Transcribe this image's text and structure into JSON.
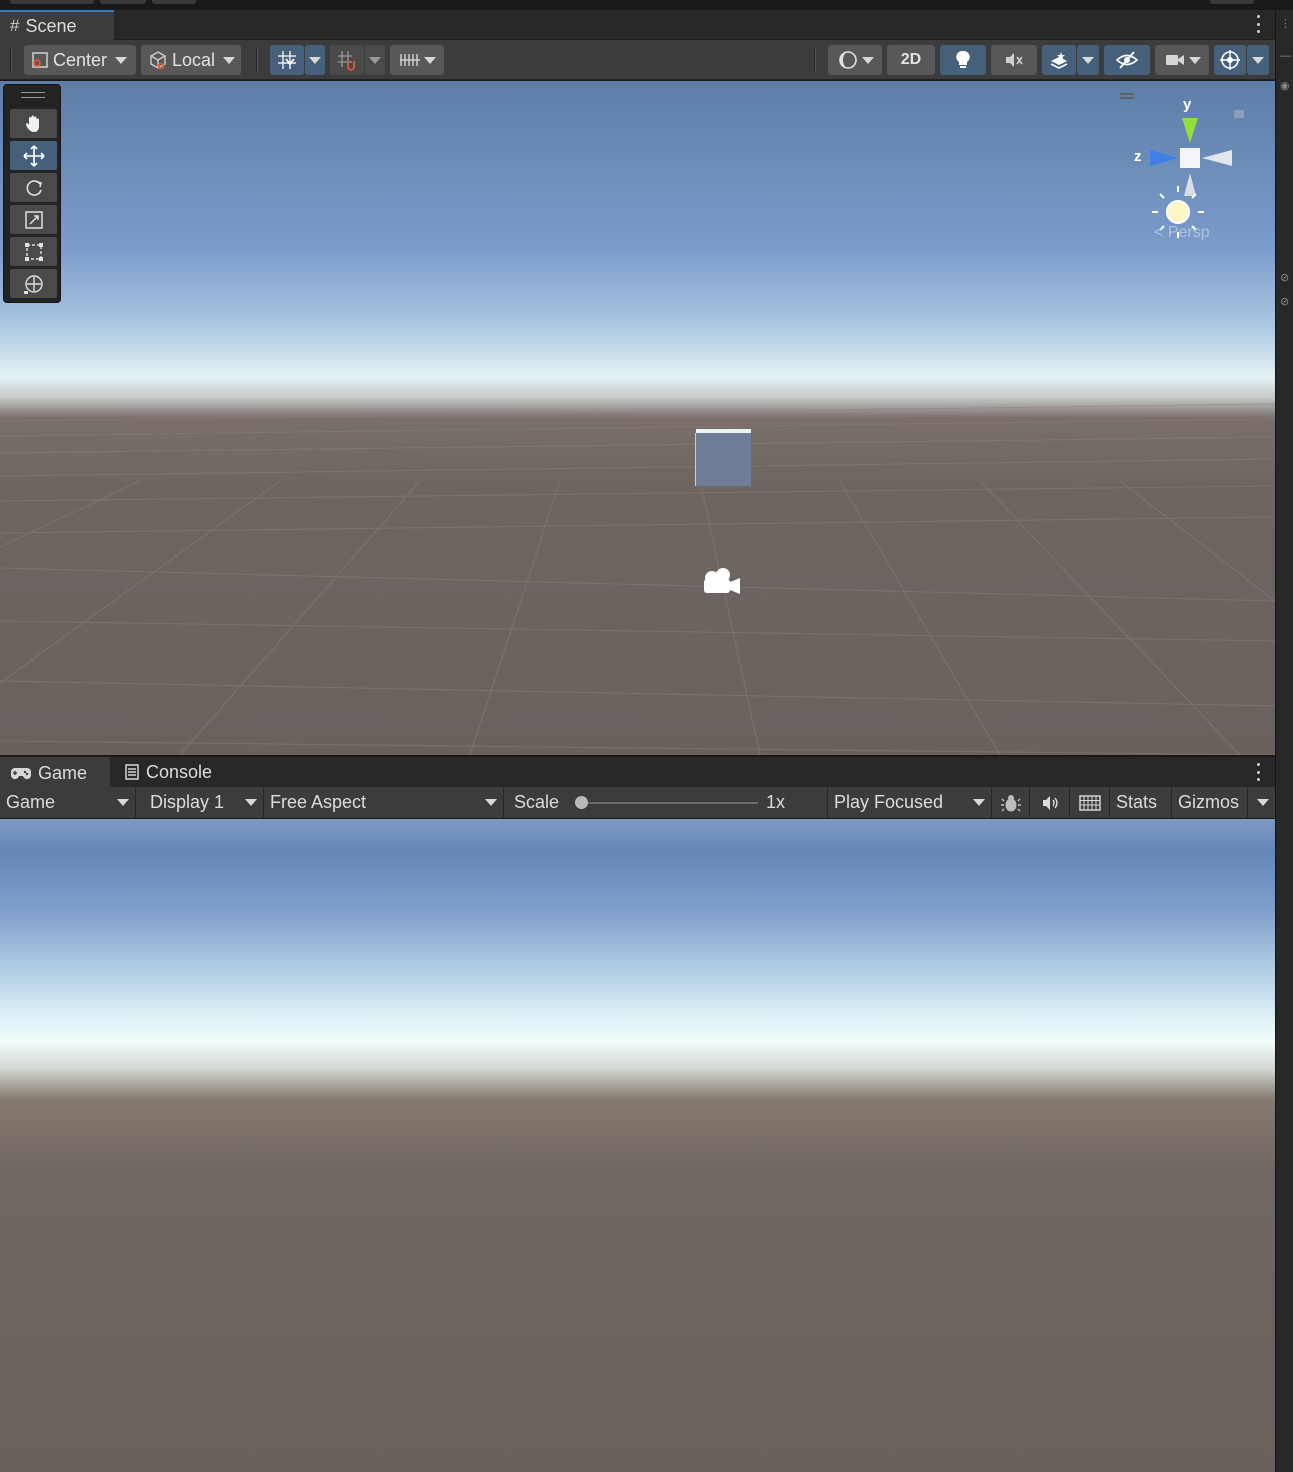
{
  "scene": {
    "tab_label": "Scene",
    "toolbar": {
      "pivot_label": "Center",
      "space_label": "Local",
      "mode_2d_label": "2D"
    },
    "gizmo": {
      "y_label": "y",
      "z_label": "z",
      "projection_label": "Persp"
    }
  },
  "game": {
    "tabs": [
      {
        "label": "Game"
      },
      {
        "label": "Console"
      }
    ],
    "toolbar": {
      "view_label": "Game",
      "display_label": "Display 1",
      "aspect_label": "Free Aspect",
      "scale_label": "Scale",
      "scale_value": "1x",
      "play_mode_label": "Play Focused",
      "stats_label": "Stats",
      "gizmos_label": "Gizmos"
    }
  },
  "colors": {
    "active_blue": "#46607c",
    "tab_accent": "#3a79bb",
    "panel_bg": "#3c3c3c"
  }
}
